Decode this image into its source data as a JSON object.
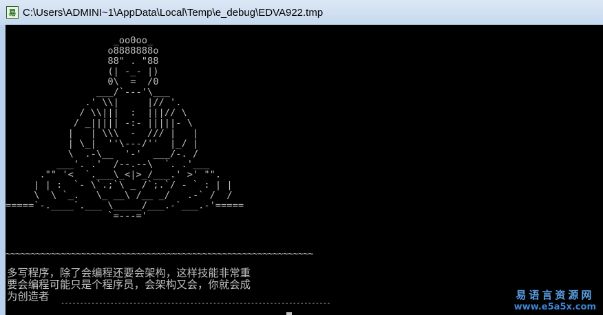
{
  "window": {
    "title": "C:\\Users\\ADMINI~1\\AppData\\Local\\Temp\\e_debug\\EDVA922.tmp",
    "icon": "e-language-app-icon"
  },
  "console": {
    "ascii_art": "                   _oo0oo_\n                  o8888888o\n                  88\" . \"88\n                  (| -_- |)\n                  0\\  =  /0\n                ___/`---'\\___\n              .' \\\\|     |// '.\n             / \\\\|||  :  |||// \\\n            / _||||| -:- |||||- \\\n           |   | \\\\\\  -  /// |   |\n           | \\_|  ''\\---/''  |_/ |\n           \\  .-\\__  '-'  ___/-. /\n         ___'. .'  /--.--\\  `. .'___\n      .\"\" '<  `.___\\_<|>_/___.' >' \"\".\n     | | :  `- \\`.;`\\ _ /`;.`/ - ` : | |\n     \\  \\ `_.   \\_ __\\ /__ _/   .-` /  /\n=====`-.____`.___ \\_____/___.-`___.-'=====\n                  `=---='",
    "separator": "~~~~~~~~~~~~~~~~~~~~~~~~~~~~~~~~~~~~~~~~~~~~~~~~~~~~~~~~~~~~~",
    "message_lines": [
      "多写程序，除了会编程还要会架构，这样技能非常重",
      "要会编程可能只是个程序员，会架构又会，你就会成",
      "为创造者"
    ],
    "bottom_rule": "-----------------------------------------------------------------------"
  },
  "watermark": {
    "cn": "易语言资源网",
    "url": "www.e5a5x.com"
  },
  "colors": {
    "console_bg": "#000000",
    "console_fg": "#c0c0c0",
    "titlebar": "#c7d9ef",
    "watermark": "#4a90d9"
  }
}
